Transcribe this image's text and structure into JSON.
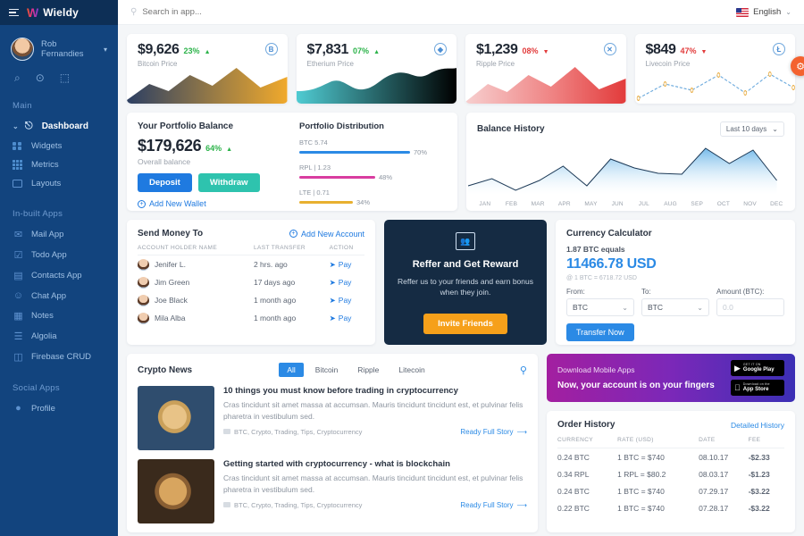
{
  "brand": {
    "logo": "W",
    "name": "Wieldy"
  },
  "sidebar": {
    "profile": {
      "name": "Rob Fernandies",
      "caret": "▾"
    },
    "quick_icons": [
      {
        "name": "search-icon",
        "glyph": "⌕"
      },
      {
        "name": "notification-icon",
        "glyph": "⊙"
      },
      {
        "name": "message-icon",
        "glyph": "⬚"
      }
    ],
    "sections": [
      {
        "title": "Main",
        "items": [
          {
            "label": "Dashboard",
            "icon": "speedometer-icon",
            "active": true
          },
          {
            "label": "Widgets",
            "icon": "widgets-icon",
            "active": false
          },
          {
            "label": "Metrics",
            "icon": "metrics-icon",
            "active": false
          },
          {
            "label": "Layouts",
            "icon": "layouts-icon",
            "active": false
          }
        ]
      },
      {
        "title": "In-built Apps",
        "items": [
          {
            "label": "Mail App",
            "icon": "mail-icon",
            "active": false
          },
          {
            "label": "Todo App",
            "icon": "todo-icon",
            "active": false
          },
          {
            "label": "Contacts App",
            "icon": "contacts-icon",
            "active": false
          },
          {
            "label": "Chat App",
            "icon": "chat-icon",
            "active": false
          },
          {
            "label": "Notes",
            "icon": "notes-icon",
            "active": false
          },
          {
            "label": "Algolia",
            "icon": "algolia-icon",
            "active": false
          },
          {
            "label": "Firebase CRUD",
            "icon": "firebase-icon",
            "active": false
          }
        ]
      },
      {
        "title": "Social Apps",
        "items": [
          {
            "label": "Profile",
            "icon": "profile-icon",
            "active": false
          }
        ]
      }
    ]
  },
  "topbar": {
    "search_placeholder": "Search in app...",
    "language": "English",
    "lang_caret": "⌄"
  },
  "stats": [
    {
      "amount": "$9,626",
      "pct": "23%",
      "dir": "up",
      "label": "Bitcoin Price",
      "coin": "B",
      "accent": "#e8a838"
    },
    {
      "amount": "$7,831",
      "pct": "07%",
      "dir": "up",
      "label": "Etherium Price",
      "coin": "◆",
      "accent": "#2fb892"
    },
    {
      "amount": "$1,239",
      "pct": "08%",
      "dir": "down",
      "label": "Ripple Price",
      "coin": "✕",
      "accent": "#ef6262"
    },
    {
      "amount": "$849",
      "pct": "47%",
      "dir": "down",
      "label": "Livecoin Price",
      "coin": "Ł",
      "accent": "#57a8e0"
    }
  ],
  "portfolio": {
    "title": "Your Portfolio Balance",
    "amount": "$179,626",
    "pct": "64%",
    "sub": "Overall balance",
    "deposit": "Deposit",
    "withdraw": "Withdraw",
    "add_wallet": "Add New Wallet",
    "distribution_title": "Portfolio Distribution",
    "distribution": [
      {
        "label": "BTC  5.74",
        "pct": "70%",
        "width": 70,
        "color": "#2b8ae5"
      },
      {
        "label": "RPL | 1.23",
        "pct": "48%",
        "width": 48,
        "color": "#d93da0"
      },
      {
        "label": "LTE | 0.71",
        "pct": "34%",
        "width": 34,
        "color": "#e8b030"
      }
    ]
  },
  "balance_history": {
    "title": "Balance History",
    "range": "Last 10 days",
    "caret": "⌄"
  },
  "chart_data": [
    {
      "type": "area",
      "title": "Balance History",
      "categories": [
        "JAN",
        "FEB",
        "MAR",
        "APR",
        "MAY",
        "JUN",
        "JUL",
        "AUG",
        "SEP",
        "OCT",
        "NOV",
        "DEC"
      ],
      "values": [
        18,
        30,
        10,
        28,
        56,
        20,
        66,
        50,
        44,
        42,
        86,
        58,
        84,
        14
      ],
      "xlabel": "",
      "ylabel": "",
      "ylim": [
        0,
        100
      ],
      "grid": false,
      "legend": "none"
    },
    {
      "type": "area",
      "title": "Bitcoin Price",
      "values": [
        10,
        42,
        55,
        30,
        68,
        38,
        92,
        48
      ],
      "ylim": [
        0,
        100
      ]
    },
    {
      "type": "area",
      "title": "Etherium Price",
      "values": [
        30,
        35,
        52,
        40,
        32,
        58,
        80,
        70
      ],
      "ylim": [
        0,
        100
      ]
    },
    {
      "type": "area",
      "title": "Ripple Price",
      "values": [
        8,
        40,
        54,
        28,
        62,
        40,
        90,
        20
      ],
      "ylim": [
        0,
        100
      ]
    },
    {
      "type": "line",
      "title": "Livecoin Price",
      "values": [
        12,
        48,
        36,
        70,
        30,
        72,
        26
      ],
      "ylim": [
        0,
        100
      ]
    }
  ],
  "send_money": {
    "title": "Send Money To",
    "add": "Add New Account",
    "headers": [
      "ACCOUNT HOLDER NAME",
      "LAST TRANSFER",
      "ACTION"
    ],
    "rows": [
      {
        "name": "Jenifer L.",
        "last": "2 hrs. ago",
        "action": "Pay"
      },
      {
        "name": "Jim Green",
        "last": "17 days ago",
        "action": "Pay"
      },
      {
        "name": "Joe Black",
        "last": "1 month ago",
        "action": "Pay"
      },
      {
        "name": "Mila Alba",
        "last": "1 month ago",
        "action": "Pay"
      }
    ]
  },
  "refer": {
    "title": "Reffer and Get Reward",
    "body": "Reffer us to your friends and earn bonus when they join.",
    "button": "Invite Friends"
  },
  "calculator": {
    "title": "Currency Calculator",
    "equals_line": "1.87 BTC equals",
    "result": "11466.78 USD",
    "rate": "@ 1 BTC = 6718.72 USD",
    "from_label": "From:",
    "from_value": "BTC",
    "to_label": "To:",
    "to_value": "BTC",
    "amount_label": "Amount (BTC):",
    "amount_placeholder": "0.0",
    "button": "Transfer Now"
  },
  "news": {
    "title": "Crypto News",
    "tabs": [
      "All",
      "Bitcoin",
      "Ripple",
      "Litecoin"
    ],
    "active_tab": "All",
    "items": [
      {
        "headline": "10 things you must know before trading in cryptocurrency",
        "body": "Cras tincidunt sit amet massa at accumsan. Mauris tincidunt tincidunt est, et pulvinar felis pharetra in vestibulum sed.",
        "tags": "BTC, Crypto, Trading, Tips, Cryptocurrency",
        "more": "Ready Full Story"
      },
      {
        "headline": "Getting started with cryptocurrency - what is blockchain",
        "body": "Cras tincidunt sit amet massa at accumsan. Mauris tincidunt tincidunt est, et pulvinar felis pharetra in vestibulum sed.",
        "tags": "BTC, Crypto, Trading, Tips, Cryptocurrency",
        "more": "Ready Full Story"
      }
    ]
  },
  "promo": {
    "small": "Download Mobile Apps",
    "big": "Now, your account is on your fingers",
    "stores": [
      {
        "top": "GET IT ON",
        "name": "Google Play",
        "glyph": "▶"
      },
      {
        "top": "Download on the",
        "name": "App Store",
        "glyph": ""
      }
    ]
  },
  "order_history": {
    "title": "Order History",
    "link": "Detailed History",
    "headers": [
      "CURRENCY",
      "RATE (USD)",
      "DATE",
      "FEE"
    ],
    "rows": [
      {
        "currency": "0.24 BTC",
        "rate": "1 BTC = $740",
        "date": "08.10.17",
        "fee": "-$2.33"
      },
      {
        "currency": "0.34 RPL",
        "rate": "1 RPL = $80.2",
        "date": "08.03.17",
        "fee": "-$1.23"
      },
      {
        "currency": "0.24 BTC",
        "rate": "1 BTC = $740",
        "date": "07.29.17",
        "fee": "-$3.22"
      },
      {
        "currency": "0.22 BTC",
        "rate": "1 BTC = $740",
        "date": "07.28.17",
        "fee": "-$3.22"
      }
    ]
  },
  "fab": {
    "glyph": "⚙"
  }
}
